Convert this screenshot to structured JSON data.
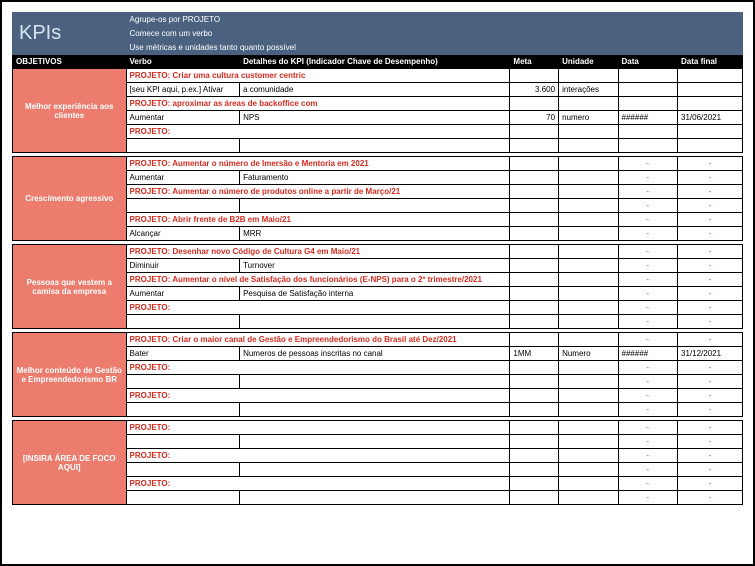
{
  "header": {
    "title": "KPIs",
    "sub1": "Agrupe-os por PROJETO",
    "sub2": "Comece com um verbo",
    "sub3": "Use métricas e unidades tanto quanto possível"
  },
  "cols": {
    "obj": "OBJETIVOS",
    "verbo": "Verbo",
    "detalhes": "Detalhes do KPI (Indicador Chave de Desempenho)",
    "meta": "Meta",
    "unidade": "Unidade",
    "data": "Data",
    "datafinal": "Data final"
  },
  "dash": "-",
  "sec1": {
    "obj": "Melhor experiência aos clientes",
    "p1": "PROJETO: Criar uma cultura customer centric",
    "r1": {
      "verbo": "[seu KPI aqui, p.ex.] Ativar",
      "det": "a comunidade",
      "meta": "3.600",
      "unid": "interações",
      "data": "",
      "datafinal": ""
    },
    "p2": "PROJETO: aproximar as áreas de backoffice com",
    "r2": {
      "verbo": "Aumentar",
      "det": "NPS",
      "meta": "70",
      "unid": "numero",
      "data": "######",
      "datafinal": "31/06/2021"
    },
    "p3": "PROJETO:"
  },
  "sec2": {
    "obj": "Crescimento agressivo",
    "p1": "PROJETO: Aumentar o número de Imersão e Mentoria em 2021",
    "r1": {
      "verbo": "Aumentar",
      "det": "Faturamento"
    },
    "p2": "PROJETO: Aumentar o número de produtos online a partir de Março/21",
    "p3": "PROJETO: Abrir frente de B2B em Maio/21",
    "r3": {
      "verbo": "Alcançar",
      "det": "MRR"
    }
  },
  "sec3": {
    "obj": "Pessoas que vestem a camisa da empresa",
    "p1": "PROJETO: Desenhar novo Código de Cultura G4 em Maio/21",
    "r1": {
      "verbo": "Diminuir",
      "det": "Turnover"
    },
    "p2": "PROJETO: Aumentar o nível de Satisfação dos funcionários (E-NPS) para o 2º trimestre/2021",
    "r2": {
      "verbo": "Aumentar",
      "det": "Pesquisa de Satisfação interna"
    },
    "p3": "PROJETO:"
  },
  "sec4": {
    "obj": "Melhor conteúdo de Gestão e Empreendedorismo BR",
    "p1": "PROJETO: Criar o maior canal de Gestão e Empreendedorismo do Brasil até Dez/2021",
    "r1": {
      "verbo": "Bater",
      "det": "Numeros de pessoas inscritas no canal",
      "meta": "1MM",
      "unid": "Numero",
      "data": "######",
      "datafinal": "31/12/2021"
    },
    "p2": "PROJETO:",
    "p3": "PROJETO:"
  },
  "sec5": {
    "obj": "[INSIRA ÁREA DE FOCO AQUI]",
    "p1": "PROJETO:",
    "p2": "PROJETO:",
    "p3": "PROJETO:"
  }
}
